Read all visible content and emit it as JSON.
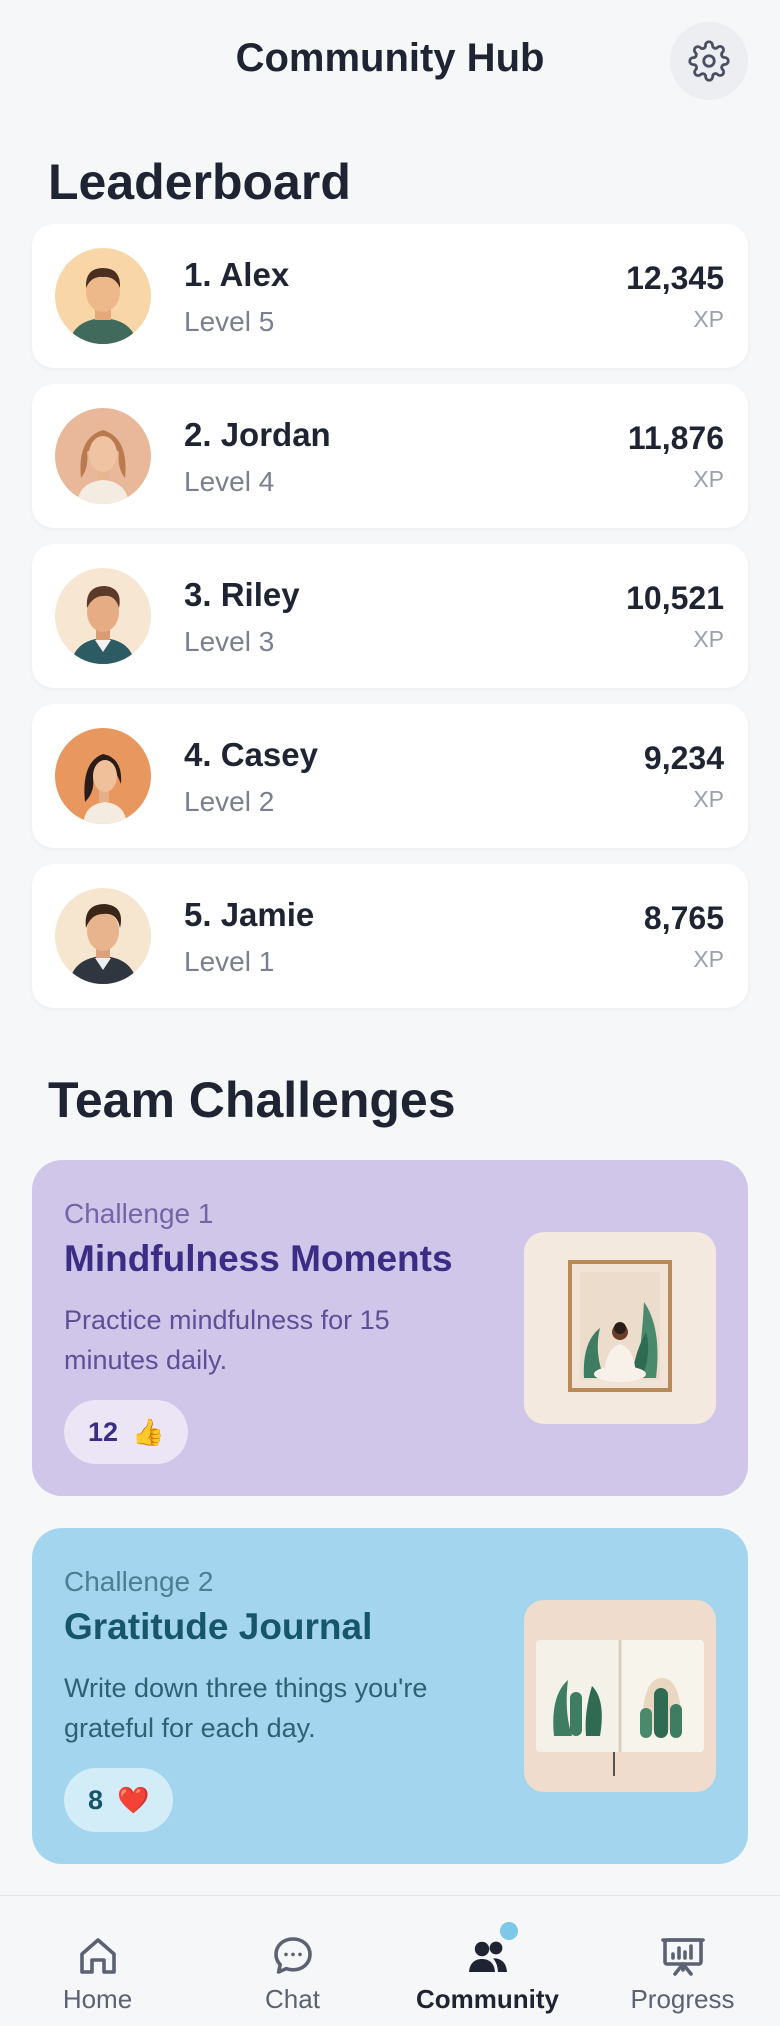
{
  "header": {
    "title": "Community Hub",
    "settings_icon": "gear-icon"
  },
  "leaderboard": {
    "title": "Leaderboard",
    "entries": [
      {
        "name": "1. Alex",
        "level": "Level 5",
        "xp": "12,345",
        "unit": "XP"
      },
      {
        "name": "2. Jordan",
        "level": "Level 4",
        "xp": "11,876",
        "unit": "XP"
      },
      {
        "name": "3. Riley",
        "level": "Level 3",
        "xp": "10,521",
        "unit": "XP"
      },
      {
        "name": "4. Casey",
        "level": "Level 2",
        "xp": "9,234",
        "unit": "XP"
      },
      {
        "name": "5. Jamie",
        "level": "Level 1",
        "xp": "8,765",
        "unit": "XP"
      }
    ]
  },
  "challenges": {
    "title": "Team Challenges",
    "items": [
      {
        "label": "Challenge 1",
        "name": "Mindfulness Moments",
        "description": "Practice mindfulness for 15 minutes daily.",
        "count": "12",
        "emoji": "👍",
        "bg_color": "#d0c6e9"
      },
      {
        "label": "Challenge 2",
        "name": "Gratitude Journal",
        "description": "Write down three things you're grateful for each day.",
        "count": "8",
        "emoji": "❤️",
        "bg_color": "#a3d6ee"
      }
    ]
  },
  "nav": {
    "items": [
      {
        "label": "Home",
        "icon": "home-icon"
      },
      {
        "label": "Chat",
        "icon": "chat-icon"
      },
      {
        "label": "Community",
        "icon": "community-icon",
        "active": true
      },
      {
        "label": "Progress",
        "icon": "progress-icon"
      }
    ]
  }
}
